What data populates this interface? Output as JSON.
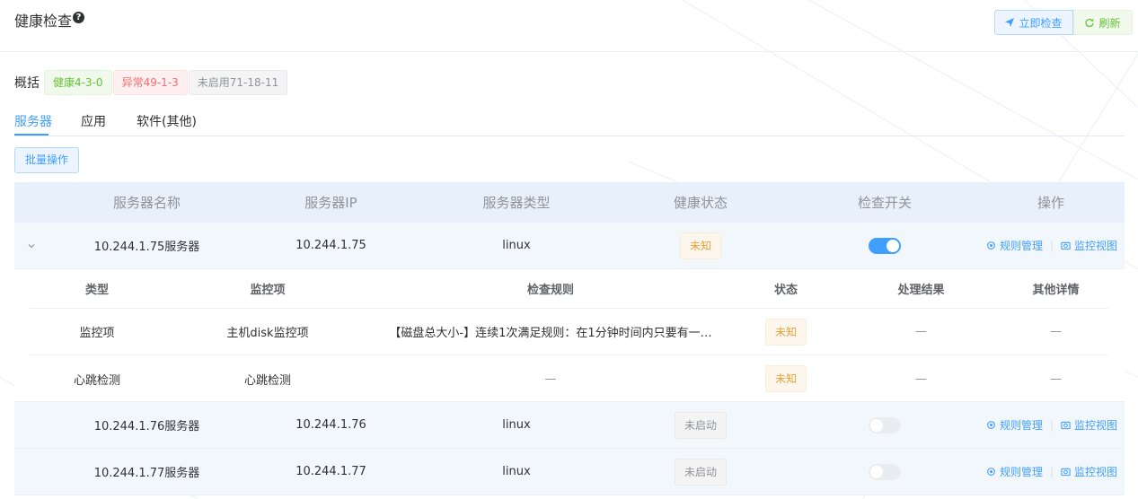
{
  "header": {
    "title": "健康检查",
    "help_icon": "question-circle-icon",
    "check_now_label": "立即检查",
    "refresh_label": "刷新"
  },
  "overview": {
    "label": "概括",
    "healthy": "健康4-3-0",
    "abnormal": "异常49-1-3",
    "disabled": "未启用71-18-11"
  },
  "tabs": [
    "服务器",
    "应用",
    "软件(其他)"
  ],
  "active_tab": 0,
  "batch_label": "批量操作",
  "table": {
    "columns": [
      "服务器名称",
      "服务器IP",
      "服务器类型",
      "健康状态",
      "检查开关",
      "操作"
    ],
    "rows": [
      {
        "name": "10.244.1.75服务器",
        "ip": "10.244.1.75",
        "type": "linux",
        "status": "未知",
        "switch_on": true,
        "expanded": true
      },
      {
        "name": "10.244.1.76服务器",
        "ip": "10.244.1.76",
        "type": "linux",
        "status": "未启动",
        "switch_on": false,
        "expanded": false
      },
      {
        "name": "10.244.1.77服务器",
        "ip": "10.244.1.77",
        "type": "linux",
        "status": "未启动",
        "switch_on": false,
        "expanded": false
      }
    ],
    "op_rules": "规则管理",
    "op_monitor": "监控视图"
  },
  "sub_table": {
    "columns": [
      "类型",
      "监控项",
      "检查规则",
      "状态",
      "处理结果",
      "其他详情"
    ],
    "rows": [
      {
        "type": "监控项",
        "item": "主机disk监控项",
        "rule": "【磁盘总大小-】连续1次满足规则：在1分钟时间内只要有一…",
        "status": "未知",
        "result": "—",
        "detail": "—"
      },
      {
        "type": "心跳检测",
        "item": "心跳检测",
        "rule": "—",
        "status": "未知",
        "result": "—",
        "detail": "—"
      }
    ]
  },
  "colors": {
    "primary": "#409eff",
    "success": "#67c23a",
    "danger": "#f56c6c",
    "warning": "#e6a23c",
    "info": "#909399",
    "header_bg": "#e7f0fb"
  }
}
